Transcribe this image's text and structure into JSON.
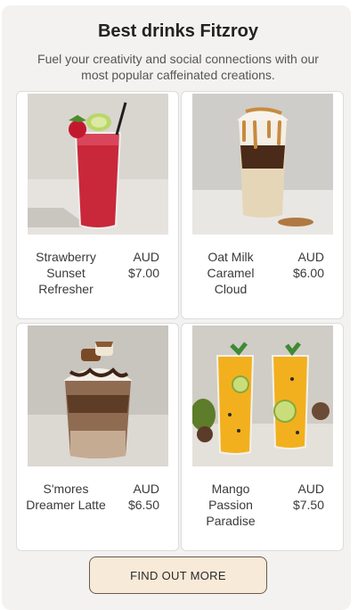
{
  "header": {
    "title": "Best drinks Fitzroy",
    "subtitle": "Fuel your creativity and social connections with our most popular caffeinated creations."
  },
  "products": [
    {
      "name": "Strawberry Sunset Refresher",
      "currency": "AUD",
      "price": "$7.00",
      "image": "strawberry-drink-photo"
    },
    {
      "name": "Oat Milk Caramel Cloud",
      "currency": "AUD",
      "price": "$6.00",
      "image": "caramel-latte-photo"
    },
    {
      "name": "S'mores Dreamer Latte",
      "currency": "AUD",
      "price": "$6.50",
      "image": "smores-latte-photo"
    },
    {
      "name": "Mango Passion Paradise",
      "currency": "AUD",
      "price": "$7.50",
      "image": "mango-passion-photo"
    }
  ],
  "cta": {
    "label": "FIND OUT MORE"
  },
  "colors": {
    "page_bg": "#f3f2f1",
    "button_bg": "#f8ead8",
    "button_border": "#6b5a4a"
  }
}
